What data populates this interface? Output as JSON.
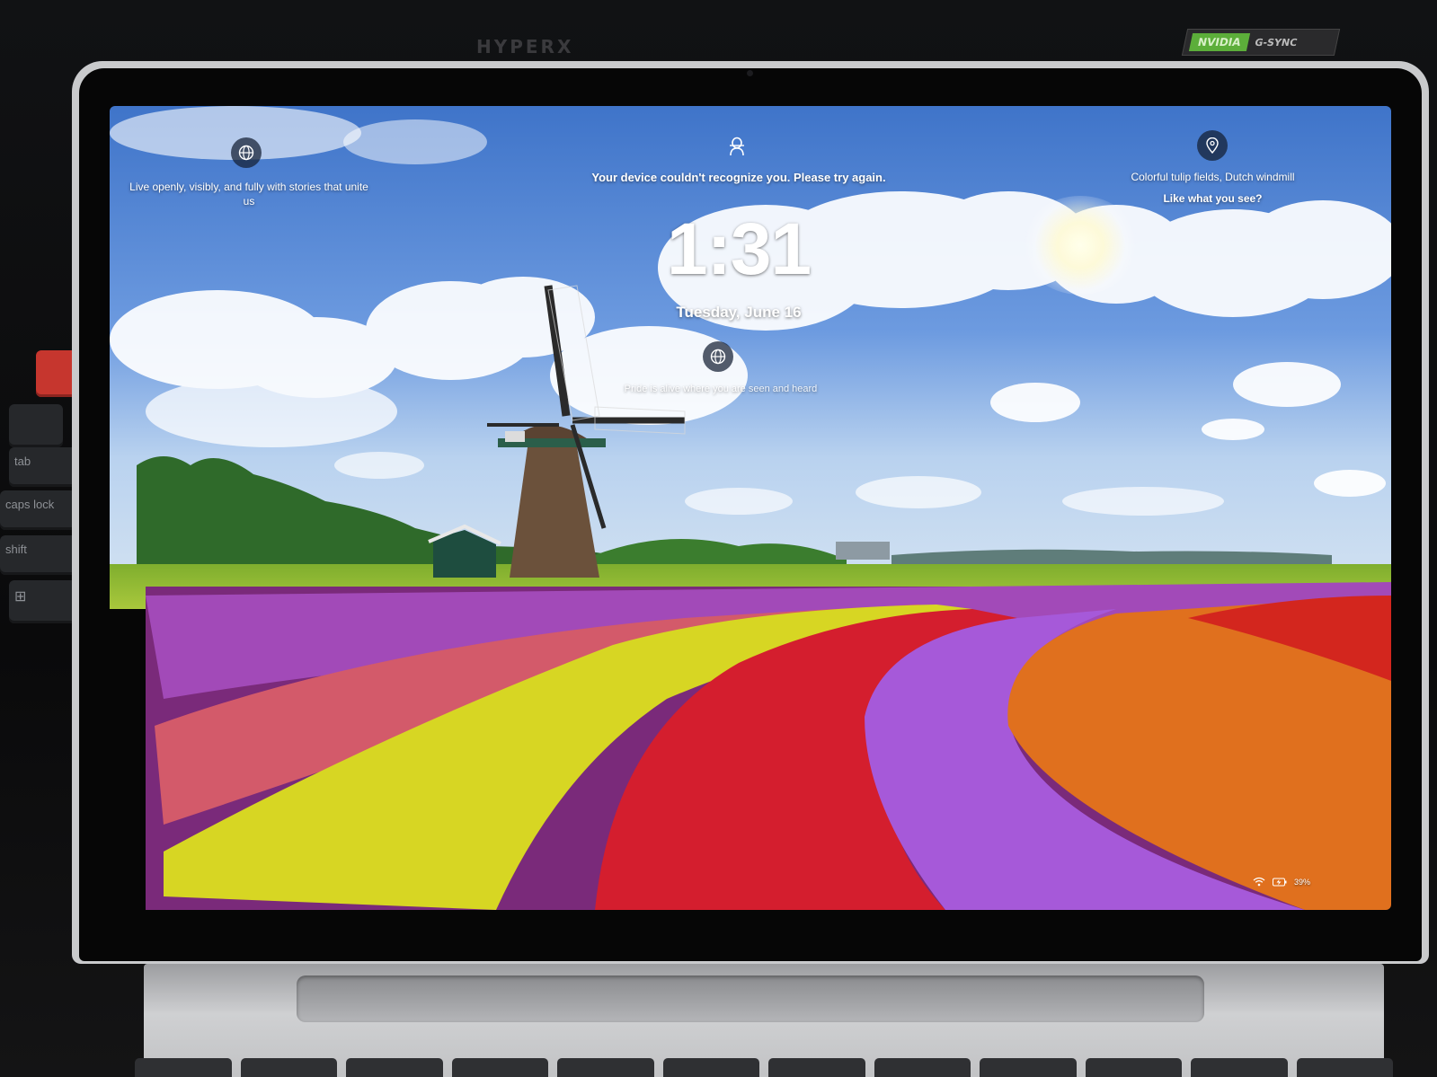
{
  "environment": {
    "monitor_logo": "HYPERX",
    "gpu_badge_brand": "NVIDIA",
    "gpu_badge_feature": "G-SYNC",
    "keyboard_keys": [
      "tab",
      "caps lock",
      "shift"
    ]
  },
  "lockscreen": {
    "spotlight_left": {
      "icon": "globe-icon",
      "text": "Live openly, visibly, and fully with stories that unite us"
    },
    "auth": {
      "icon": "face-recognition-icon",
      "message": "Your device couldn't recognize you. Please try again."
    },
    "clock": {
      "time": "1:31",
      "date": "Tuesday, June 16"
    },
    "spotlight_center": {
      "icon": "globe-icon",
      "text": "Pride is alive where you are seen and heard"
    },
    "spotlight_right": {
      "icon": "location-pin-icon",
      "title": "Colorful tulip fields, Dutch windmill",
      "subtitle": "Like what you see?"
    },
    "status": {
      "wifi_icon": "wifi-icon",
      "battery_icon": "battery-charging-icon",
      "battery_percent": "39%"
    }
  }
}
